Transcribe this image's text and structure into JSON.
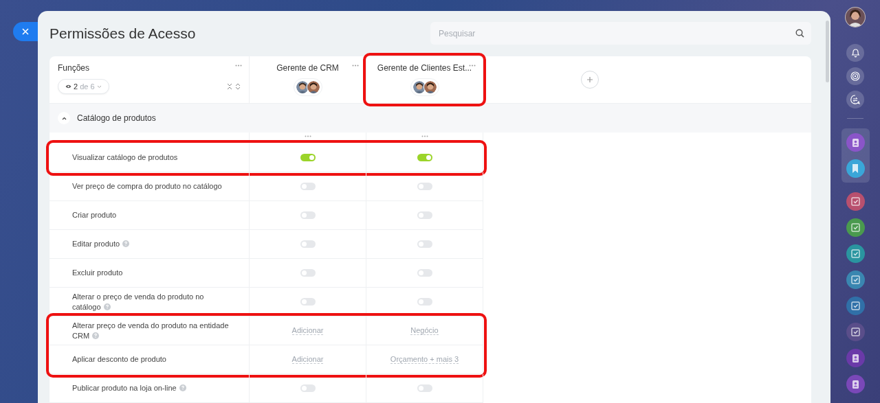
{
  "close_button": {
    "kind": "close"
  },
  "title": "Permissões de Acesso",
  "search": {
    "placeholder": "Pesquisar"
  },
  "table": {
    "roles_header": {
      "label": "Funções",
      "visible_count": "2",
      "total_label": "de 6"
    },
    "columns": [
      {
        "name": "Gerente de CRM",
        "highlighted": false
      },
      {
        "name": "Gerente de Clientes Est...",
        "highlighted": true
      }
    ],
    "section": {
      "label": "Catálogo de produtos",
      "expanded": true
    },
    "rows": [
      {
        "label": "Visualizar catálogo de produtos",
        "help": false,
        "highlighted": true,
        "cells": [
          {
            "kind": "toggle",
            "on": true
          },
          {
            "kind": "toggle",
            "on": true
          }
        ]
      },
      {
        "label": "Ver preço de compra do produto no catálogo",
        "help": false,
        "highlighted": false,
        "cells": [
          {
            "kind": "toggle",
            "on": false
          },
          {
            "kind": "toggle",
            "on": false
          }
        ]
      },
      {
        "label": "Criar produto",
        "help": false,
        "highlighted": false,
        "cells": [
          {
            "kind": "toggle",
            "on": false
          },
          {
            "kind": "toggle",
            "on": false
          }
        ]
      },
      {
        "label": "Editar produto",
        "help": true,
        "highlighted": false,
        "cells": [
          {
            "kind": "toggle",
            "on": false
          },
          {
            "kind": "toggle",
            "on": false
          }
        ]
      },
      {
        "label": "Excluir produto",
        "help": false,
        "highlighted": false,
        "cells": [
          {
            "kind": "toggle",
            "on": false
          },
          {
            "kind": "toggle",
            "on": false
          }
        ]
      },
      {
        "label": "Alterar o preço de venda do produto no catálogo",
        "help": true,
        "highlighted": false,
        "cells": [
          {
            "kind": "toggle",
            "on": false
          },
          {
            "kind": "toggle",
            "on": false
          }
        ]
      },
      {
        "label": "Alterar preço de venda do produto na entidade CRM",
        "help": true,
        "highlighted": true,
        "cells": [
          {
            "kind": "link",
            "text": "Adicionar"
          },
          {
            "kind": "link",
            "text": "Negócio"
          }
        ]
      },
      {
        "label": "Aplicar desconto de produto",
        "help": false,
        "highlighted": true,
        "cells": [
          {
            "kind": "link",
            "text": "Adicionar"
          },
          {
            "kind": "link",
            "text": "Orçamento + mais 3"
          }
        ]
      },
      {
        "label": "Publicar produto na loja on-line",
        "help": true,
        "highlighted": false,
        "cells": [
          {
            "kind": "toggle",
            "on": false
          },
          {
            "kind": "toggle",
            "on": false
          }
        ]
      }
    ]
  },
  "sidebar": {
    "tools": [
      {
        "kind": "bell"
      },
      {
        "kind": "swirl"
      },
      {
        "kind": "chat"
      }
    ],
    "pinned": [
      {
        "kind": "contact",
        "color": "#8a55c8"
      },
      {
        "kind": "bookmark",
        "color": "#3aa6d8"
      }
    ],
    "items": [
      {
        "kind": "task",
        "color": "#b8506e"
      },
      {
        "kind": "task",
        "color": "#4a9a4e"
      },
      {
        "kind": "task",
        "color": "#2a95a0"
      },
      {
        "kind": "task",
        "color": "#3a86b0"
      },
      {
        "kind": "task",
        "color": "#3070a8"
      },
      {
        "kind": "task",
        "color": "#5a4e8a"
      },
      {
        "kind": "contact",
        "color": "#6a3aa8"
      },
      {
        "kind": "contact",
        "color": "#7a48b8"
      }
    ]
  }
}
